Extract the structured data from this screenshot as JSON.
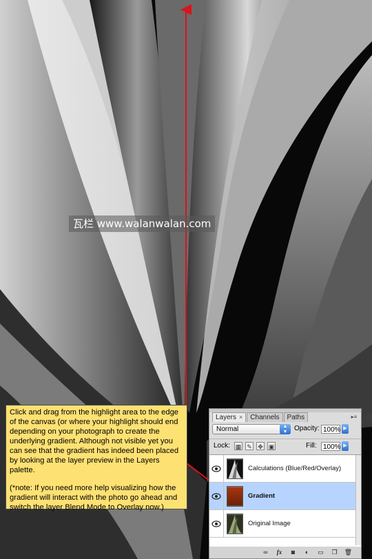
{
  "watermark": "瓦栏 www.walanwalan.com",
  "instruction": {
    "paragraph1": "Click and drag from the highlight area to the edge of the canvas (or where your highlight should end depending on your photograph to create the underlying gradient. Although not visible yet you can see that the gradient has indeed been placed by looking at the layer preview in the Layers palette.",
    "paragraph2": "(*note: If you need more help visualizing how the gradient will interact with the photo go ahead and switch the layer Blend Mode to Overlay now.)"
  },
  "layers_panel": {
    "tabs": [
      {
        "label": "Layers",
        "close_icon": "×"
      },
      {
        "label": "Channels"
      },
      {
        "label": "Paths"
      }
    ],
    "blend_mode": "Normal",
    "opacity_label": "Opacity:",
    "opacity_value": "100%",
    "lock_label": "Lock:",
    "fill_label": "Fill:",
    "fill_value": "100%",
    "layers": [
      {
        "name": "Calculations (Blue/Red/Overlay)",
        "thumb": "grayscale-plant"
      },
      {
        "name": "Gradient",
        "thumb": "orange-gradient",
        "selected": true
      },
      {
        "name": "Original Image",
        "thumb": "color-plant"
      }
    ],
    "bottom_icons": [
      "link-icon",
      "fx-icon",
      "mask-icon",
      "adjustment-icon",
      "folder-icon",
      "new-layer-icon",
      "trash-icon"
    ],
    "fx_label": "fx"
  },
  "colors": {
    "arrow": "#d9141c",
    "note_bg": "#fde173",
    "selection": "#b6d4ff",
    "gradient_thumb": "#8a2b0b"
  }
}
